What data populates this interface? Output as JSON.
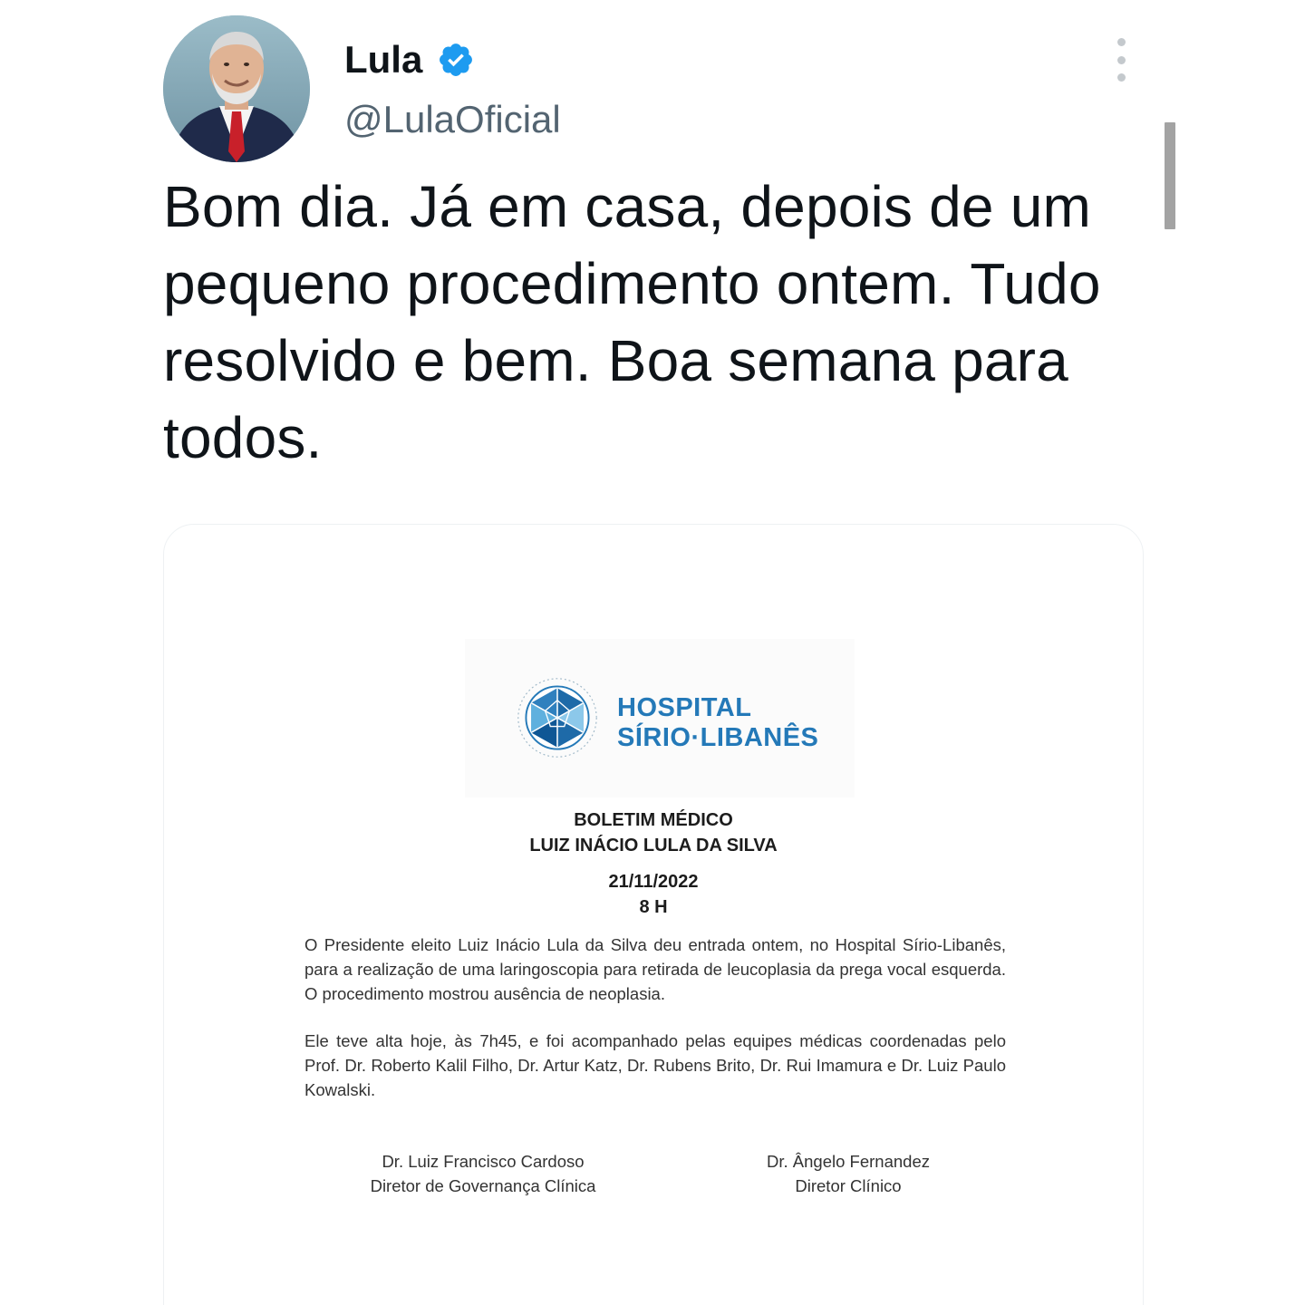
{
  "author": {
    "display_name": "Lula",
    "handle": "@LulaOficial",
    "verified": true
  },
  "tweet": {
    "text": "Bom dia. Já em casa, depois de um pequeno procedimento ontem. Tudo resolvido e bem. Boa semana para todos."
  },
  "document": {
    "hospital_name_line1": "HOSPITAL",
    "hospital_name_line2": "SÍRIO·LIBANÊS",
    "title": "BOLETIM MÉDICO",
    "patient": "LUIZ INÁCIO LULA DA SILVA",
    "date": "21/11/2022",
    "time": "8 H",
    "paragraph1": "O Presidente eleito Luiz Inácio Lula da Silva deu entrada ontem, no Hospital Sírio-Libanês, para a realização de uma laringoscopia para retirada de leucoplasia da prega vocal esquerda. O procedimento mostrou ausência de neoplasia.",
    "paragraph2": "Ele teve alta hoje, às 7h45, e foi acompanhado pelas equipes médicas coordenadas pelo Prof. Dr. Roberto Kalil Filho, Dr. Artur Katz, Dr. Rubens Brito, Dr. Rui Imamura e Dr. Luiz Paulo Kowalski.",
    "signatures": [
      {
        "name": "Dr. Luiz Francisco Cardoso",
        "role": "Diretor de Governança Clínica"
      },
      {
        "name": "Dr. Ângelo Fernandez",
        "role": "Diretor Clínico"
      }
    ]
  },
  "colors": {
    "verified_badge": "#1d9bf0",
    "handle_gray": "#536471",
    "hospital_blue": "#2479b8"
  },
  "icons": {
    "verified": "verified-badge-icon",
    "more": "more-vertical-icon"
  }
}
